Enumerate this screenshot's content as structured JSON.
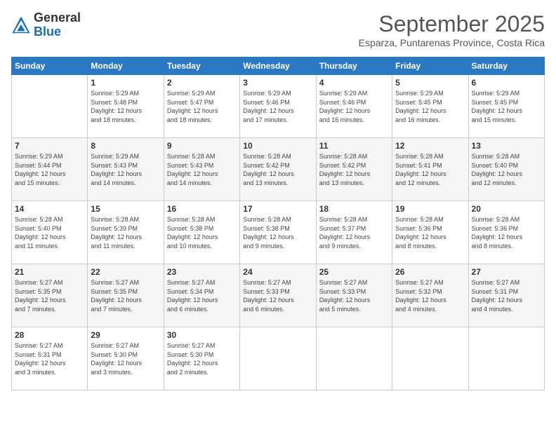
{
  "logo": {
    "general": "General",
    "blue": "Blue"
  },
  "title": "September 2025",
  "subtitle": "Esparza, Puntarenas Province, Costa Rica",
  "days_of_week": [
    "Sunday",
    "Monday",
    "Tuesday",
    "Wednesday",
    "Thursday",
    "Friday",
    "Saturday"
  ],
  "weeks": [
    [
      {
        "day": "",
        "info": ""
      },
      {
        "day": "1",
        "info": "Sunrise: 5:29 AM\nSunset: 5:48 PM\nDaylight: 12 hours\nand 18 minutes."
      },
      {
        "day": "2",
        "info": "Sunrise: 5:29 AM\nSunset: 5:47 PM\nDaylight: 12 hours\nand 18 minutes."
      },
      {
        "day": "3",
        "info": "Sunrise: 5:29 AM\nSunset: 5:46 PM\nDaylight: 12 hours\nand 17 minutes."
      },
      {
        "day": "4",
        "info": "Sunrise: 5:29 AM\nSunset: 5:46 PM\nDaylight: 12 hours\nand 16 minutes."
      },
      {
        "day": "5",
        "info": "Sunrise: 5:29 AM\nSunset: 5:45 PM\nDaylight: 12 hours\nand 16 minutes."
      },
      {
        "day": "6",
        "info": "Sunrise: 5:29 AM\nSunset: 5:45 PM\nDaylight: 12 hours\nand 15 minutes."
      }
    ],
    [
      {
        "day": "7",
        "info": "Sunrise: 5:29 AM\nSunset: 5:44 PM\nDaylight: 12 hours\nand 15 minutes."
      },
      {
        "day": "8",
        "info": "Sunrise: 5:29 AM\nSunset: 5:43 PM\nDaylight: 12 hours\nand 14 minutes."
      },
      {
        "day": "9",
        "info": "Sunrise: 5:28 AM\nSunset: 5:43 PM\nDaylight: 12 hours\nand 14 minutes."
      },
      {
        "day": "10",
        "info": "Sunrise: 5:28 AM\nSunset: 5:42 PM\nDaylight: 12 hours\nand 13 minutes."
      },
      {
        "day": "11",
        "info": "Sunrise: 5:28 AM\nSunset: 5:42 PM\nDaylight: 12 hours\nand 13 minutes."
      },
      {
        "day": "12",
        "info": "Sunrise: 5:28 AM\nSunset: 5:41 PM\nDaylight: 12 hours\nand 12 minutes."
      },
      {
        "day": "13",
        "info": "Sunrise: 5:28 AM\nSunset: 5:40 PM\nDaylight: 12 hours\nand 12 minutes."
      }
    ],
    [
      {
        "day": "14",
        "info": "Sunrise: 5:28 AM\nSunset: 5:40 PM\nDaylight: 12 hours\nand 11 minutes."
      },
      {
        "day": "15",
        "info": "Sunrise: 5:28 AM\nSunset: 5:39 PM\nDaylight: 12 hours\nand 11 minutes."
      },
      {
        "day": "16",
        "info": "Sunrise: 5:28 AM\nSunset: 5:38 PM\nDaylight: 12 hours\nand 10 minutes."
      },
      {
        "day": "17",
        "info": "Sunrise: 5:28 AM\nSunset: 5:38 PM\nDaylight: 12 hours\nand 9 minutes."
      },
      {
        "day": "18",
        "info": "Sunrise: 5:28 AM\nSunset: 5:37 PM\nDaylight: 12 hours\nand 9 minutes."
      },
      {
        "day": "19",
        "info": "Sunrise: 5:28 AM\nSunset: 5:36 PM\nDaylight: 12 hours\nand 8 minutes."
      },
      {
        "day": "20",
        "info": "Sunrise: 5:28 AM\nSunset: 5:36 PM\nDaylight: 12 hours\nand 8 minutes."
      }
    ],
    [
      {
        "day": "21",
        "info": "Sunrise: 5:27 AM\nSunset: 5:35 PM\nDaylight: 12 hours\nand 7 minutes."
      },
      {
        "day": "22",
        "info": "Sunrise: 5:27 AM\nSunset: 5:35 PM\nDaylight: 12 hours\nand 7 minutes."
      },
      {
        "day": "23",
        "info": "Sunrise: 5:27 AM\nSunset: 5:34 PM\nDaylight: 12 hours\nand 6 minutes."
      },
      {
        "day": "24",
        "info": "Sunrise: 5:27 AM\nSunset: 5:33 PM\nDaylight: 12 hours\nand 6 minutes."
      },
      {
        "day": "25",
        "info": "Sunrise: 5:27 AM\nSunset: 5:33 PM\nDaylight: 12 hours\nand 5 minutes."
      },
      {
        "day": "26",
        "info": "Sunrise: 5:27 AM\nSunset: 5:32 PM\nDaylight: 12 hours\nand 4 minutes."
      },
      {
        "day": "27",
        "info": "Sunrise: 5:27 AM\nSunset: 5:31 PM\nDaylight: 12 hours\nand 4 minutes."
      }
    ],
    [
      {
        "day": "28",
        "info": "Sunrise: 5:27 AM\nSunset: 5:31 PM\nDaylight: 12 hours\nand 3 minutes."
      },
      {
        "day": "29",
        "info": "Sunrise: 5:27 AM\nSunset: 5:30 PM\nDaylight: 12 hours\nand 3 minutes."
      },
      {
        "day": "30",
        "info": "Sunrise: 5:27 AM\nSunset: 5:30 PM\nDaylight: 12 hours\nand 2 minutes."
      },
      {
        "day": "",
        "info": ""
      },
      {
        "day": "",
        "info": ""
      },
      {
        "day": "",
        "info": ""
      },
      {
        "day": "",
        "info": ""
      }
    ]
  ]
}
